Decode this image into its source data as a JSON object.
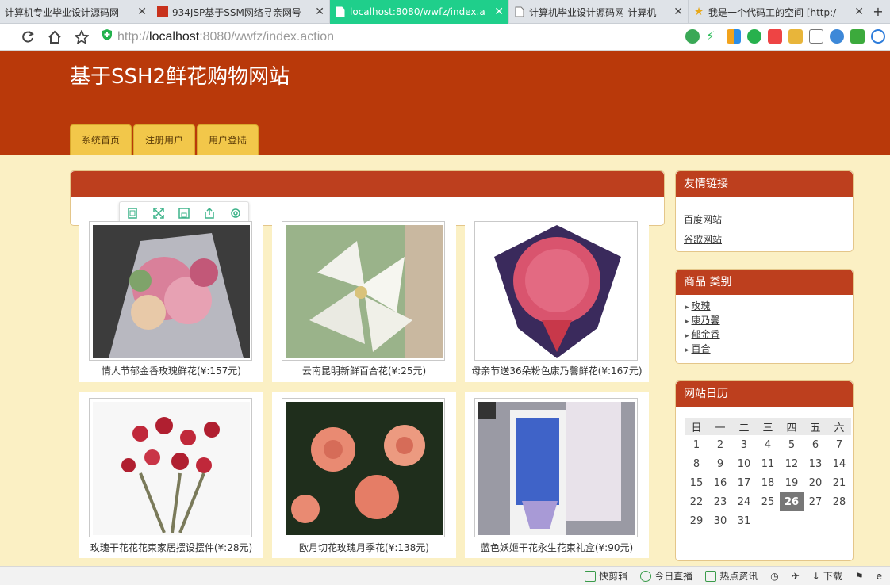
{
  "browser": {
    "tabs": [
      {
        "title": "计算机专业毕业设计源码网",
        "active": false
      },
      {
        "title": "934JSP基于SSM网络寻亲网号",
        "active": false
      },
      {
        "title": "localhost:8080/wwfz/index.a",
        "active": true
      },
      {
        "title": "计算机毕业设计源码网-计算机",
        "active": false
      },
      {
        "title": "我是一个代码工的空间 [http:/",
        "active": false
      }
    ],
    "url_scheme": "http://",
    "url_host": "localhost",
    "url_path": ":8080/wwfz/index.action",
    "new_tab": "+"
  },
  "site": {
    "title": "基于SSH2鲜花购物网站",
    "nav": [
      "系统首页",
      "注册用户",
      "用户登陆"
    ]
  },
  "products": [
    {
      "name": "情人节郁金香玫瑰鲜花(¥:157元)",
      "color": "#d9809a"
    },
    {
      "name": "云南昆明新鲜百合花(¥:25元)",
      "color": "#e8ede4"
    },
    {
      "name": "母亲节送36朵粉色康乃馨鲜花(¥:167元)",
      "color": "#d9546e"
    },
    {
      "name": "玫瑰干花花花束家居摆设摆件(¥:28元)",
      "color": "#c0283a"
    },
    {
      "name": "欧月切花玫瑰月季花(¥:138元)",
      "color": "#e98a72"
    },
    {
      "name": "蓝色妖姬干花永生花束礼盒(¥:90元)",
      "color": "#3f63c8"
    }
  ],
  "sidebar": {
    "links_title": "友情链接",
    "links": [
      "百度网站",
      "谷歌网站"
    ],
    "category_title": "商品 类别",
    "categories": [
      "玫瑰",
      "康乃馨",
      "郁金香",
      "百合"
    ],
    "calendar_title": "网站日历",
    "weekdays": [
      "日",
      "一",
      "二",
      "三",
      "四",
      "五",
      "六"
    ],
    "weeks": [
      [
        "",
        "",
        "",
        "",
        "",
        "",
        ""
      ],
      [
        "1",
        "2",
        "3",
        "4",
        "5",
        "6",
        "7"
      ],
      [
        "8",
        "9",
        "10",
        "11",
        "12",
        "13",
        "14"
      ],
      [
        "15",
        "16",
        "17",
        "18",
        "19",
        "20",
        "21"
      ],
      [
        "22",
        "23",
        "24",
        "25",
        "26",
        "27",
        "28"
      ],
      [
        "29",
        "30",
        "31",
        "",
        "",
        "",
        ""
      ]
    ],
    "today": "26"
  },
  "statusbar": {
    "items": [
      "快剪辑",
      "今日直播",
      "热点资讯",
      "下载"
    ]
  }
}
